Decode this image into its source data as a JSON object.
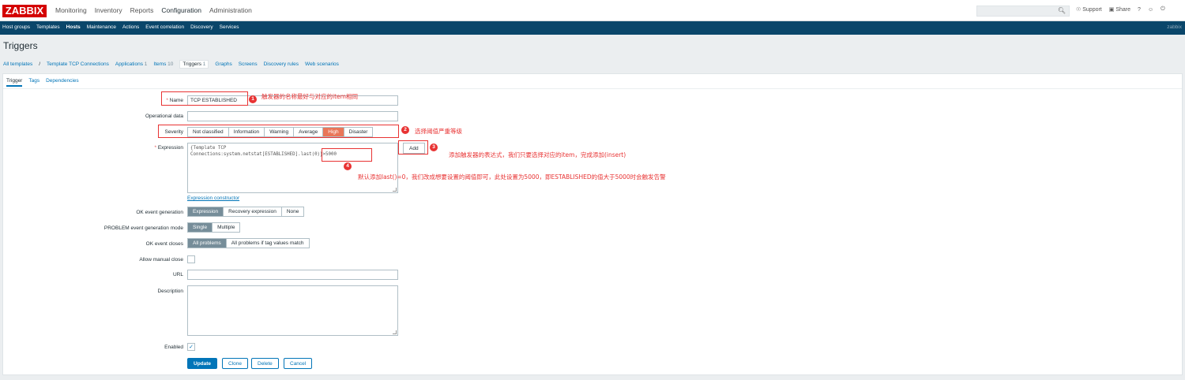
{
  "brand": {
    "logo": "ZABBIX"
  },
  "top_menu": [
    "Monitoring",
    "Inventory",
    "Reports",
    "Configuration",
    "Administration"
  ],
  "top_right": {
    "support": "Support",
    "share": "Share",
    "help": "?"
  },
  "sub_nav": {
    "items": [
      "Host groups",
      "Templates",
      "Hosts",
      "Maintenance",
      "Actions",
      "Event correlation",
      "Discovery",
      "Services"
    ],
    "active": "Hosts",
    "user": "zabbix"
  },
  "page_title": "Triggers",
  "breadcrumbs": {
    "all_templates": "All templates",
    "separator": "/",
    "template": "Template TCP Connections",
    "applications": "Applications",
    "applications_count": "1",
    "items": "Items",
    "items_count": "10",
    "triggers": "Triggers",
    "triggers_count": "1",
    "graphs": "Graphs",
    "screens": "Screens",
    "discovery_rules": "Discovery rules",
    "web_scenarios": "Web scenarios"
  },
  "tabs": [
    "Trigger",
    "Tags",
    "Dependencies"
  ],
  "form": {
    "name_label": "Name",
    "name_value": "TCP ESTABLISHED",
    "operational_label": "Operational data",
    "severity_label": "Severity",
    "severity_options": [
      "Not classified",
      "Information",
      "Warning",
      "Average",
      "High",
      "Disaster"
    ],
    "severity_selected": "High",
    "expression_label": "Expression",
    "expression_line1": "{Template TCP",
    "expression_line2": "Connections:system.netstat[ESTABLISHED]",
    "expression_func": ".last(0)}>5000",
    "add_button": "Add",
    "expression_constructor": "Expression constructor",
    "ok_event_generation_label": "OK event generation",
    "ok_event_generation_options": [
      "Expression",
      "Recovery expression",
      "None"
    ],
    "problem_mode_label": "PROBLEM event generation mode",
    "problem_mode_options": [
      "Single",
      "Multiple"
    ],
    "ok_event_closes_label": "OK event closes",
    "ok_event_closes_options": [
      "All problems",
      "All problems if tag values match"
    ],
    "manual_close_label": "Allow manual close",
    "url_label": "URL",
    "description_label": "Description",
    "enabled_label": "Enabled",
    "buttons": {
      "update": "Update",
      "clone": "Clone",
      "delete": "Delete",
      "cancel": "Cancel"
    }
  },
  "annotations": [
    {
      "num": "1",
      "text": "触发器的名称最好与对应的item相同"
    },
    {
      "num": "2",
      "text": "选择阈值严重等级"
    },
    {
      "num": "3",
      "text": "添加触发器的表达式，我们只要选择对应的item，完成添加(insert)"
    },
    {
      "num": "4",
      "text": "默认添加last()=0，我们改成想要设置的阈值即可，此处设置为5000，即ESTABLISHED的值大于5000时会触发告警"
    }
  ],
  "colors": {
    "brand_red": "#d40000",
    "nav_blue": "#0a466a",
    "link_blue": "#0275b8",
    "high": "#e97659",
    "annotation_red": "#e83333"
  }
}
